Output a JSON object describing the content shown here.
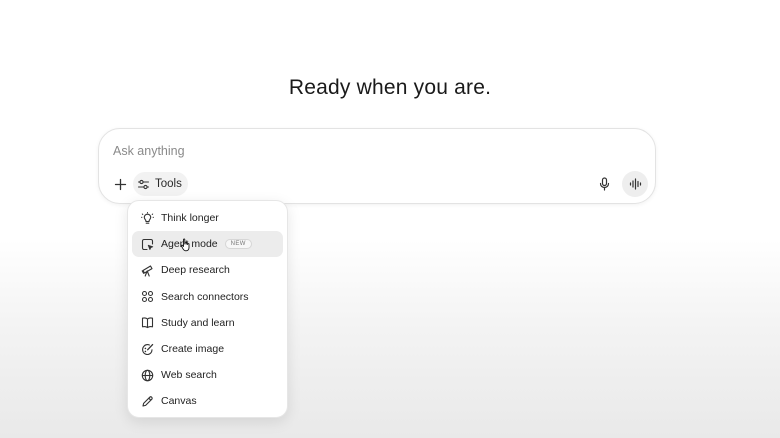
{
  "headline": "Ready when you are.",
  "composer": {
    "placeholder": "Ask anything",
    "value": "",
    "plus_icon": "plus-icon",
    "tools_label": "Tools",
    "tools_icon": "sliders-icon",
    "mic_icon": "microphone-icon",
    "voice_icon": "voice-waveform-icon"
  },
  "tools_menu": {
    "items": [
      {
        "label": "Think longer",
        "icon": "lightbulb-icon",
        "badge": ""
      },
      {
        "label": "Agent mode",
        "icon": "agent-cursor-icon",
        "badge": "NEW",
        "hovered": true
      },
      {
        "label": "Deep research",
        "icon": "telescope-icon",
        "badge": ""
      },
      {
        "label": "Search connectors",
        "icon": "connectors-icon",
        "badge": ""
      },
      {
        "label": "Study and learn",
        "icon": "book-icon",
        "badge": ""
      },
      {
        "label": "Create image",
        "icon": "image-brush-icon",
        "badge": ""
      },
      {
        "label": "Web search",
        "icon": "globe-icon",
        "badge": ""
      },
      {
        "label": "Canvas",
        "icon": "pencil-icon",
        "badge": ""
      }
    ]
  },
  "colors": {
    "background": "#ffffff",
    "hover": "#ececec",
    "text": "#1f1f1f",
    "placeholder": "#8a8a8a"
  }
}
